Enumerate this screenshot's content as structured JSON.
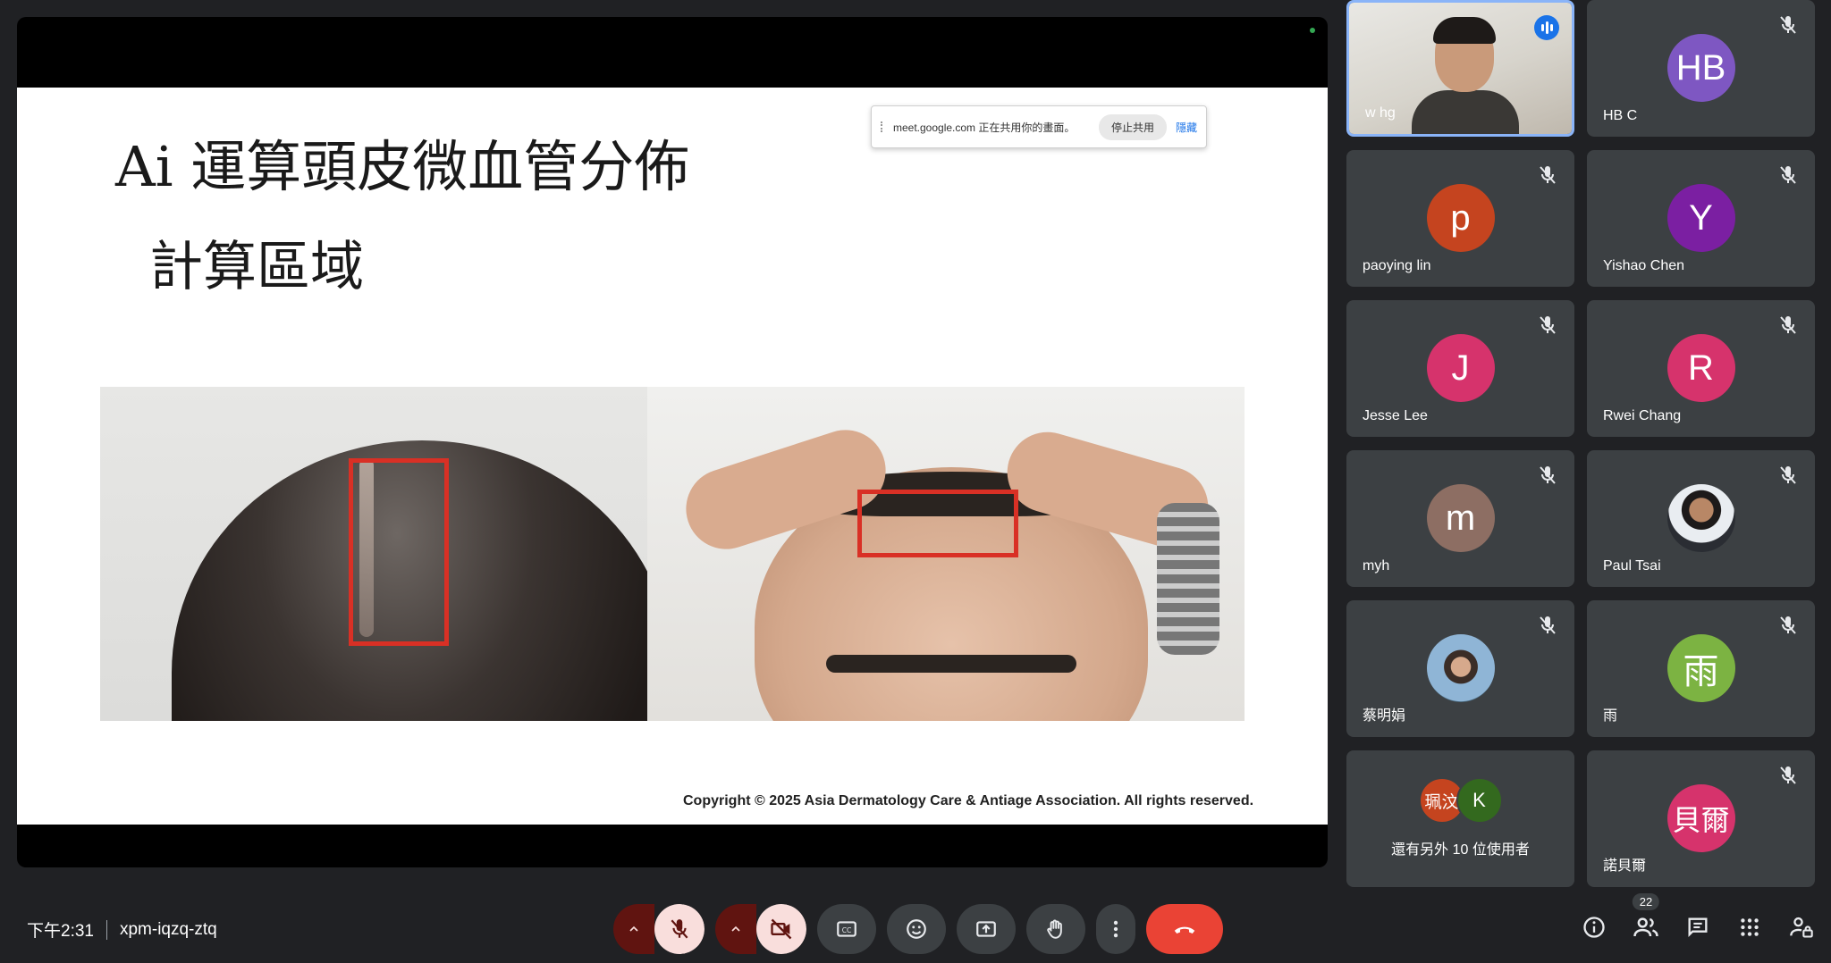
{
  "slide": {
    "title": "Ai 運算頭皮微血管分佈",
    "subtitle": "計算區域",
    "copyright": "Copyright © 2025 Asia Dermatology Care & Antiage Association.  All rights reserved."
  },
  "share_banner": {
    "text": "meet.google.com 正在共用你的畫面。",
    "stop_label": "停止共用",
    "hide_label": "隱藏"
  },
  "participants": [
    {
      "name": "w hg",
      "type": "video",
      "speaking": true
    },
    {
      "name": "HB C",
      "initials": "HB",
      "color": "#7e57c2",
      "muted": true
    },
    {
      "name": "paoying lin",
      "initials": "p",
      "color": "#c5441f",
      "muted": true
    },
    {
      "name": "Yishao Chen",
      "initials": "Y",
      "color": "#7b1fa2",
      "muted": true
    },
    {
      "name": "Jesse Lee",
      "initials": "J",
      "color": "#d6336c",
      "muted": true
    },
    {
      "name": "Rwei Chang",
      "initials": "R",
      "color": "#d6336c",
      "muted": true
    },
    {
      "name": "myh",
      "initials": "m",
      "color": "#8d6e63",
      "muted": true
    },
    {
      "name": "Paul Tsai",
      "type": "photo",
      "muted": true
    },
    {
      "name": "蔡明娟",
      "type": "photo",
      "muted": true
    },
    {
      "name": "雨",
      "initials": "雨",
      "color": "#7cb342",
      "muted": true
    },
    {
      "name": "還有另外 10 位使用者",
      "type": "more",
      "minis": [
        {
          "initials": "珮汶",
          "color": "#c5441f"
        },
        {
          "initials": "K",
          "color": "#33691e"
        }
      ]
    },
    {
      "name": "諾貝爾",
      "initials": "貝爾",
      "color": "#d6336c",
      "muted": true
    }
  ],
  "bottom_bar": {
    "time": "下午2:31",
    "meeting_code": "xpm-iqzq-ztq",
    "participant_count": "22"
  },
  "icons": {
    "mic": "mic-off-icon",
    "camera": "videocam-off-icon",
    "captions": "closed-caption-icon",
    "emoji": "emoji-icon",
    "present": "present-screen-icon",
    "hand": "raise-hand-icon",
    "more": "more-vert-icon",
    "end": "call-end-icon"
  },
  "colors": {
    "accent": "#8ab4f8",
    "end_call": "#ea4335",
    "speaking": "#1a73e8"
  }
}
